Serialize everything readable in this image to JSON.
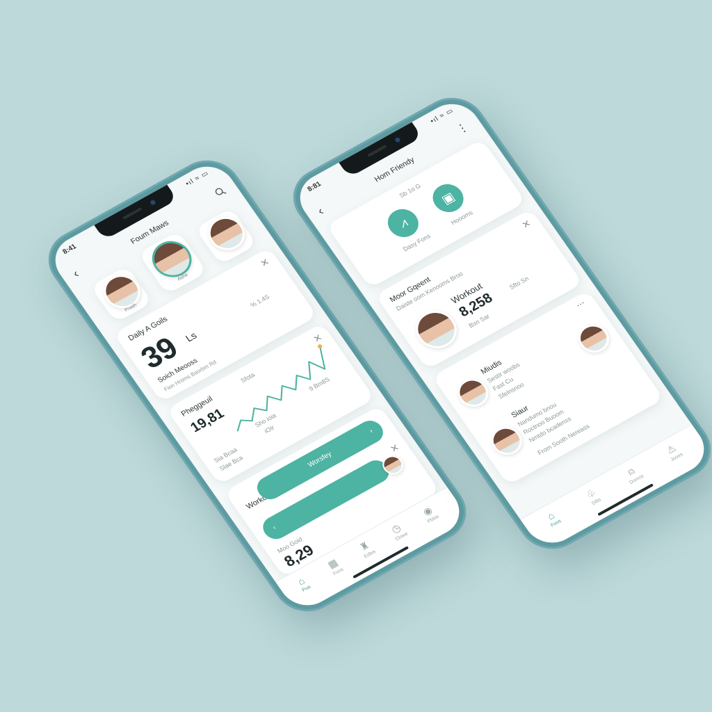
{
  "colors": {
    "background": "#bdd9da",
    "frame": "#5e9aa1",
    "accent": "#4db3a2",
    "chart_line": "#4db3a2",
    "chart_peak": "#e9b24a"
  },
  "left_phone": {
    "status": {
      "time": "8:41",
      "signal": "•ıl ≈ ▭"
    },
    "header": {
      "title": "Foum Maws",
      "back_icon": "chevron-left-icon",
      "search_icon": "search-icon"
    },
    "friends": [
      {
        "label": "Prash"
      },
      {
        "label": "Ashe"
      },
      {
        "label": ""
      }
    ],
    "daily_card": {
      "title": "Daily A Goils",
      "value": "39",
      "unit": "Ls",
      "side_text": "% 1.4S",
      "subtitle": "Soich Meooss",
      "detail": "Fion Hroms Baorbm Rd"
    },
    "progress_card": {
      "title": "Pheggeuil",
      "top_label": "Sfota",
      "value": "19,81",
      "stat_a": "Sho ioia",
      "stat_b": "iOIr",
      "stat_c": "9 Bm8S",
      "stat_d": "Sia Bcaa",
      "foot": "Slae Bca"
    },
    "workout_card": {
      "title": "Workout",
      "button_label": "Worsfey",
      "sub_label": "Moo Goid",
      "value": "8,29"
    },
    "tabs": [
      {
        "label": "Pua",
        "icon": "home-icon"
      },
      {
        "label": "Fons",
        "icon": "calendar-icon"
      },
      {
        "label": "Edles",
        "icon": "dumbbell-icon"
      },
      {
        "label": "Clowe",
        "icon": "clock-icon"
      },
      {
        "label": "Pblse",
        "icon": "profile-icon"
      }
    ]
  },
  "right_phone": {
    "status": {
      "time": "8:81",
      "signal": "•ıl ≈ ▭"
    },
    "header": {
      "title": "Hom Friendy",
      "back_icon": "chevron-left-icon",
      "more_icon": "more-vertical-icon"
    },
    "quick_card": {
      "caption": "Sb 1o G",
      "actions": [
        {
          "label": "Dasy Fons",
          "icon": "activity-icon"
        },
        {
          "label": "Hoooms",
          "icon": "video-icon"
        }
      ]
    },
    "goal_card": {
      "title": "Moor Gqeent",
      "subtitle": "Daiste oom Kenooms Broo",
      "label": "Workout",
      "value": "8,258",
      "side_text": "Sfto Sn",
      "foot": "Bsn Sar"
    },
    "friends_card": {
      "items": [
        {
          "name": "Miudis",
          "line1": "Sestir woobs",
          "line2": "Fast Cu",
          "line3": "Sfelnsnoo"
        },
        {
          "name": "Siaur",
          "line1": "Nandumo bnou",
          "line2": "Roctnoo Buoom",
          "line3": "Nmtdo bcadenss"
        }
      ],
      "footer": "From Sooth Nereass"
    },
    "tabs": [
      {
        "label": "Fons",
        "icon": "home-icon"
      },
      {
        "label": "Dilts",
        "icon": "bell-icon"
      },
      {
        "label": "Domos",
        "icon": "lock-icon"
      },
      {
        "label": "Jooes",
        "icon": "alert-icon"
      }
    ]
  },
  "chart_data": {
    "type": "line",
    "title": "",
    "x": [
      1,
      2,
      3,
      4,
      5,
      6,
      7,
      8,
      9,
      10,
      11,
      12,
      13,
      14
    ],
    "series": [
      {
        "values": [
          3,
          7,
          4,
          9,
          5,
          11,
          6,
          12,
          7,
          13,
          8,
          16,
          9,
          20
        ]
      }
    ]
  }
}
